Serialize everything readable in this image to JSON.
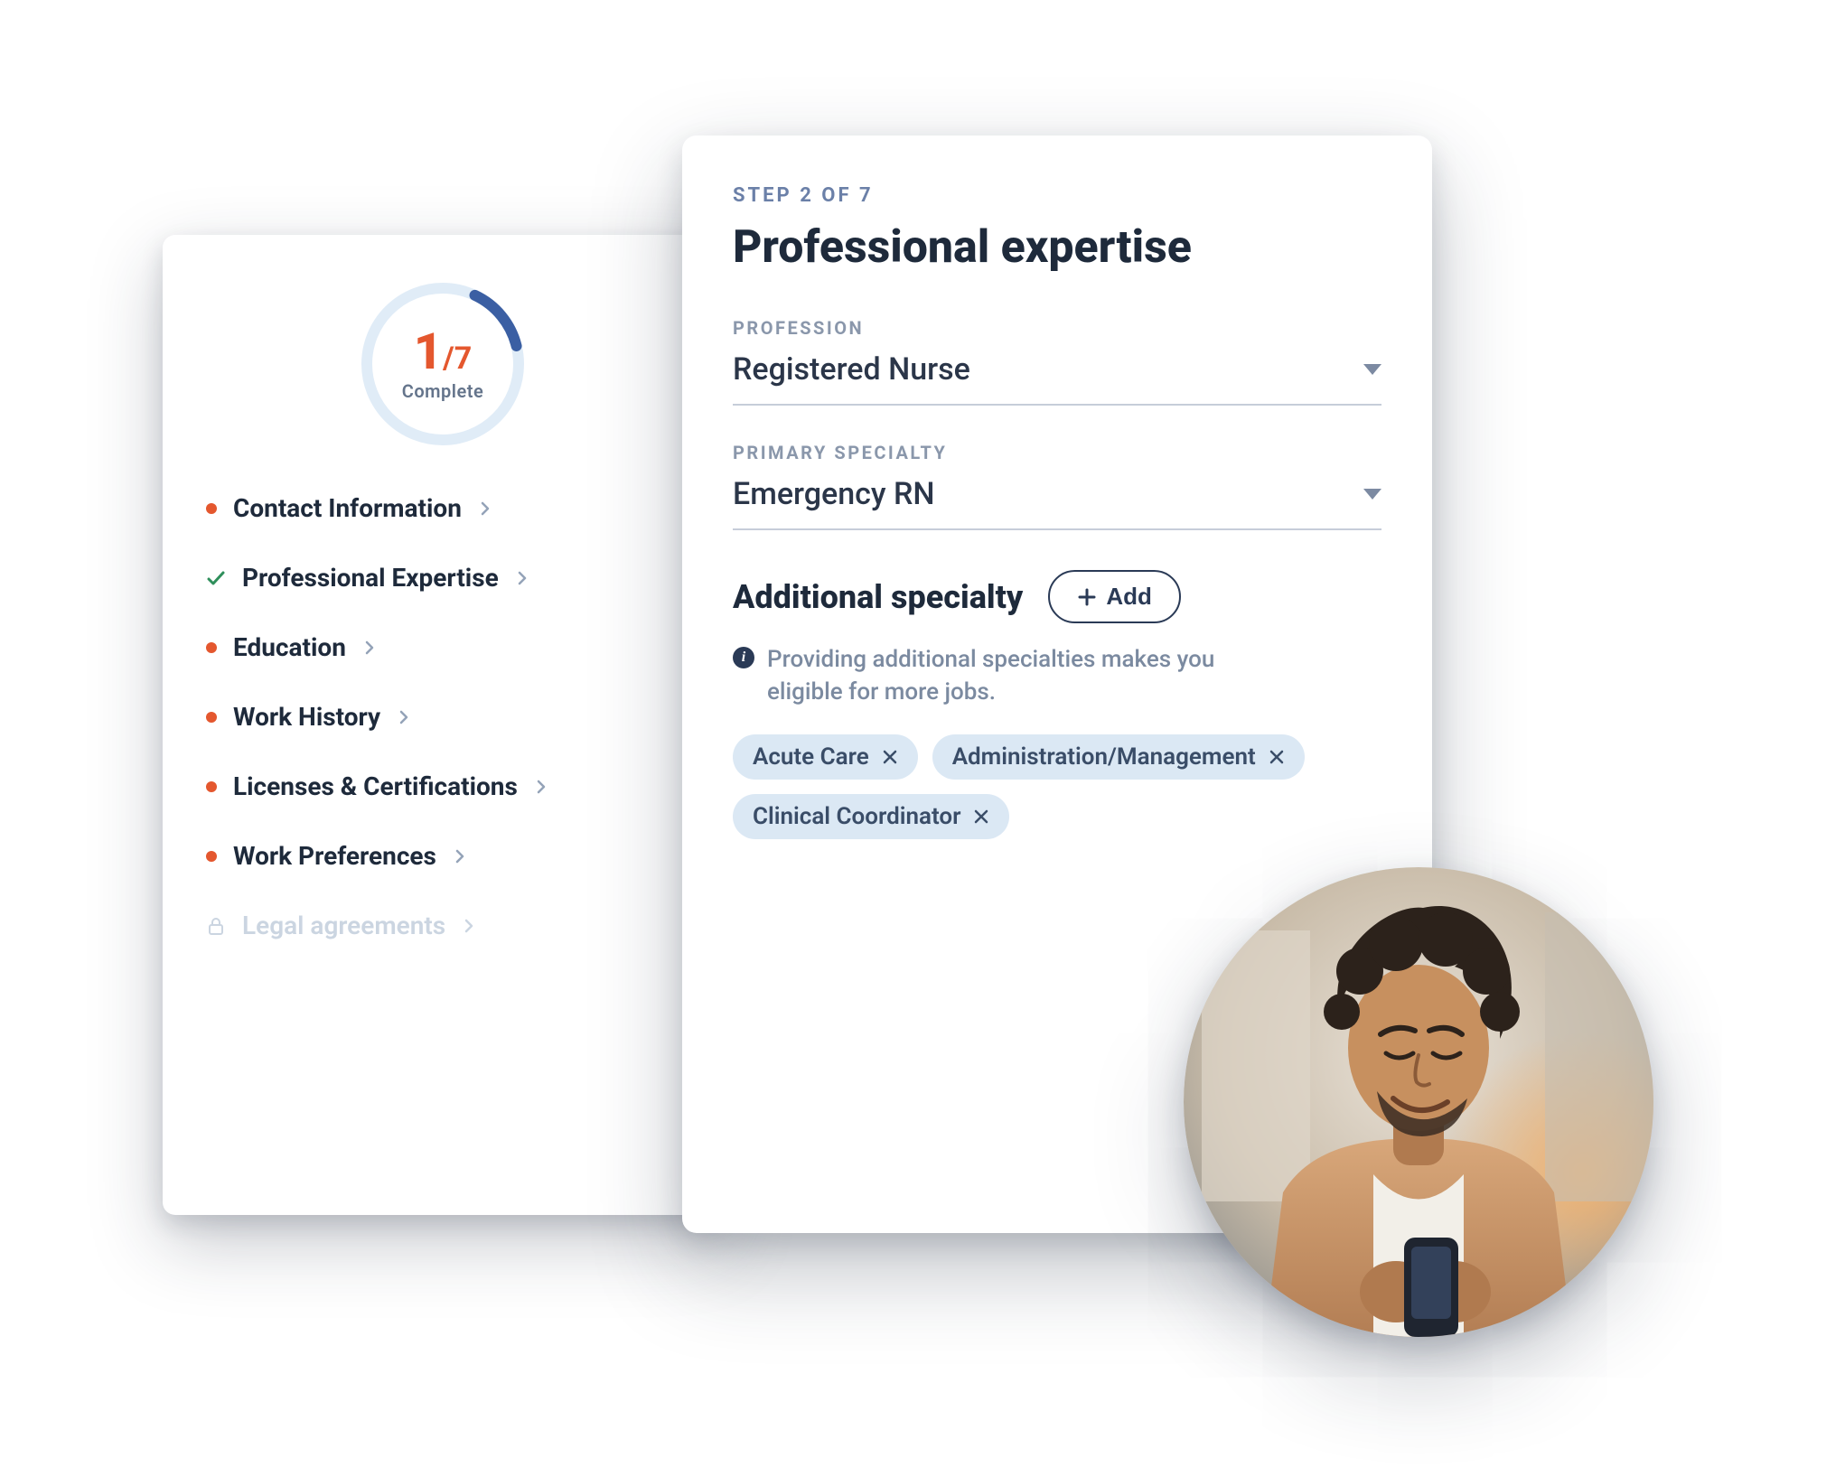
{
  "sidebar": {
    "progress": {
      "current": "1",
      "separator": "/",
      "total": "7",
      "label": "Complete"
    },
    "items": [
      {
        "label": "Contact Information",
        "status": "incomplete"
      },
      {
        "label": "Professional Expertise",
        "status": "complete"
      },
      {
        "label": "Education",
        "status": "incomplete"
      },
      {
        "label": "Work History",
        "status": "incomplete"
      },
      {
        "label": "Licenses & Certifications",
        "status": "incomplete"
      },
      {
        "label": "Work Preferences",
        "status": "incomplete"
      },
      {
        "label": "Legal agreements",
        "status": "locked"
      }
    ]
  },
  "form": {
    "step_label": "STEP 2 OF 7",
    "title": "Professional expertise",
    "profession": {
      "label": "PROFESSION",
      "value": "Registered Nurse"
    },
    "specialty": {
      "label": "PRIMARY SPECIALTY",
      "value": "Emergency RN"
    },
    "additional": {
      "heading": "Additional specialty",
      "add_label": "Add",
      "info": "Providing additional specialties makes you eligible for more jobs.",
      "chips": [
        "Acute Care",
        "Administration/Management",
        "Clinical Coordinator"
      ]
    }
  }
}
